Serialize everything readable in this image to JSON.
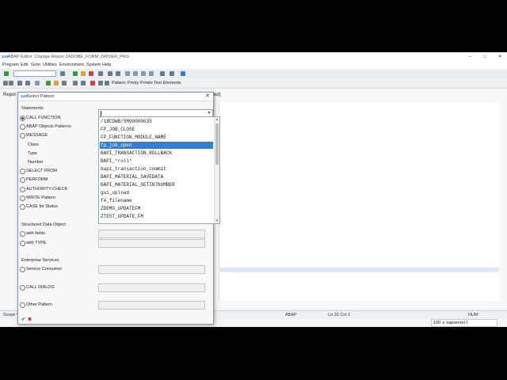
{
  "window": {
    "logo": "SAP",
    "title": "ABAP Editor: Change Report ZADOBE_FORM_DRIVER_PRG",
    "minimize": "–",
    "maximize": "□",
    "close": "✕"
  },
  "menubar": [
    "Program",
    "Edit",
    "Goto",
    "Utilities",
    "Environment",
    "System",
    "Help"
  ],
  "toolbar2": {
    "pattern": "Pattern",
    "pretty_printer": "Pretty Printer",
    "text_elements": "Text Elements"
  },
  "editor": {
    "report_label": "Repor",
    "report_tail": "ed)"
  },
  "statusbar": {
    "scope": "Scope \\{",
    "lang": "ABAP",
    "position": "Ln  32 Col  1",
    "num": "NUM"
  },
  "taskbar": {
    "server": "100 ∨ sapserver  I"
  },
  "dialog": {
    "logo": "SAP",
    "title": "Select Pattern",
    "close": "✕",
    "statements_header": "Statements",
    "options": [
      {
        "label": "CALL FUNCTION",
        "selected": true
      },
      {
        "label": "ABAP Objects Patterns",
        "selected": false
      },
      {
        "label": "MESSAGE",
        "selected": false
      }
    ],
    "message_fields": [
      "Class",
      "Type",
      "Number"
    ],
    "options2": [
      {
        "label": "SELECT FROM",
        "selected": false
      },
      {
        "label": "PERFORM",
        "selected": false
      },
      {
        "label": "AUTHORITY-CHECK",
        "selected": false
      },
      {
        "label": "WRITE Pattern",
        "selected": false
      },
      {
        "label": "CASE for Status",
        "selected": false
      }
    ],
    "structured_header": "Structured Data Object",
    "structured_options": [
      {
        "label": "with fields",
        "selected": false
      },
      {
        "label": "with TYPE",
        "selected": false
      }
    ],
    "enterprise_header": "Enterprise Services",
    "enterprise_options": [
      {
        "label": "Service Consumer",
        "selected": false
      }
    ],
    "call_dialog": "CALL DIALOG",
    "other_pattern": "Other Pattern",
    "ok": "✔",
    "cancel": "✖"
  },
  "dropdown": {
    "items": [
      "/1BCDWB/SM90000035",
      "FP_JOB_CLOSE",
      "FP_FUNCTION_MODULE_NAME",
      "fp_job_open",
      "BAPI_TRANSACTION_ROLLBACK",
      "BAPI_*roll*",
      "bapi_transaction_commit",
      "BAPI_MATERIAL_SAVEDATA",
      "BAPI_MATERIAL_GETINTNUMBER",
      "gui_upload",
      "f4_filename",
      "ZDEMO_UPDATEFM",
      "ZTEST_UPDATE_FM"
    ],
    "selected_index": 3
  },
  "colors": {
    "selection": "#2f7fd6",
    "accent": "#1a6fb5"
  }
}
